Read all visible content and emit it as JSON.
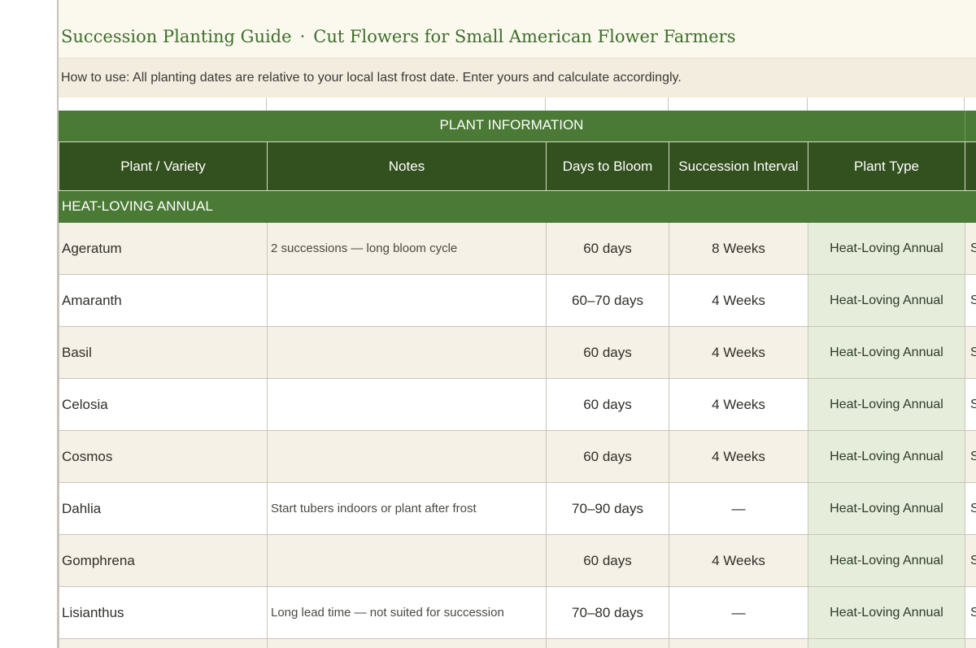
{
  "header": {
    "title": "Succession Planting Guide",
    "separator": "·",
    "subtitle": "Cut Flowers for Small American Flower Farmers",
    "instructions": "How to use: All planting dates are relative to your local last frost date. Enter yours and calculate accordingly."
  },
  "section": {
    "label": "PLANT INFORMATION"
  },
  "columns": {
    "plant": "Plant / Variety",
    "notes": "Notes",
    "days": "Days to Bloom",
    "interval": "Succession Interval",
    "type": "Plant Type"
  },
  "group": {
    "label": "HEAT-LOVING ANNUAL"
  },
  "rows": [
    {
      "plant": "Ageratum",
      "notes": "2 successions — long bloom cycle",
      "days": "60 days",
      "interval": "8 Weeks",
      "type": "Heat-Loving Annual",
      "cut": "S"
    },
    {
      "plant": "Amaranth",
      "notes": "",
      "days": "60–70 days",
      "interval": "4 Weeks",
      "type": "Heat-Loving Annual",
      "cut": "S"
    },
    {
      "plant": "Basil",
      "notes": "",
      "days": "60 days",
      "interval": "4 Weeks",
      "type": "Heat-Loving Annual",
      "cut": "S"
    },
    {
      "plant": "Celosia",
      "notes": "",
      "days": "60 days",
      "interval": "4 Weeks",
      "type": "Heat-Loving Annual",
      "cut": "S"
    },
    {
      "plant": "Cosmos",
      "notes": "",
      "days": "60 days",
      "interval": "4 Weeks",
      "type": "Heat-Loving Annual",
      "cut": "S"
    },
    {
      "plant": "Dahlia",
      "notes": "Start tubers indoors or plant after frost",
      "days": "70–90 days",
      "interval": "—",
      "type": "Heat-Loving Annual",
      "cut": "S"
    },
    {
      "plant": "Gomphrena",
      "notes": "",
      "days": "60 days",
      "interval": "4 Weeks",
      "type": "Heat-Loving Annual",
      "cut": "S"
    },
    {
      "plant": "Lisianthus",
      "notes": "Long lead time — not suited for succession",
      "days": "70–80 days",
      "interval": "—",
      "type": "Heat-Loving Annual",
      "cut": "S"
    }
  ]
}
